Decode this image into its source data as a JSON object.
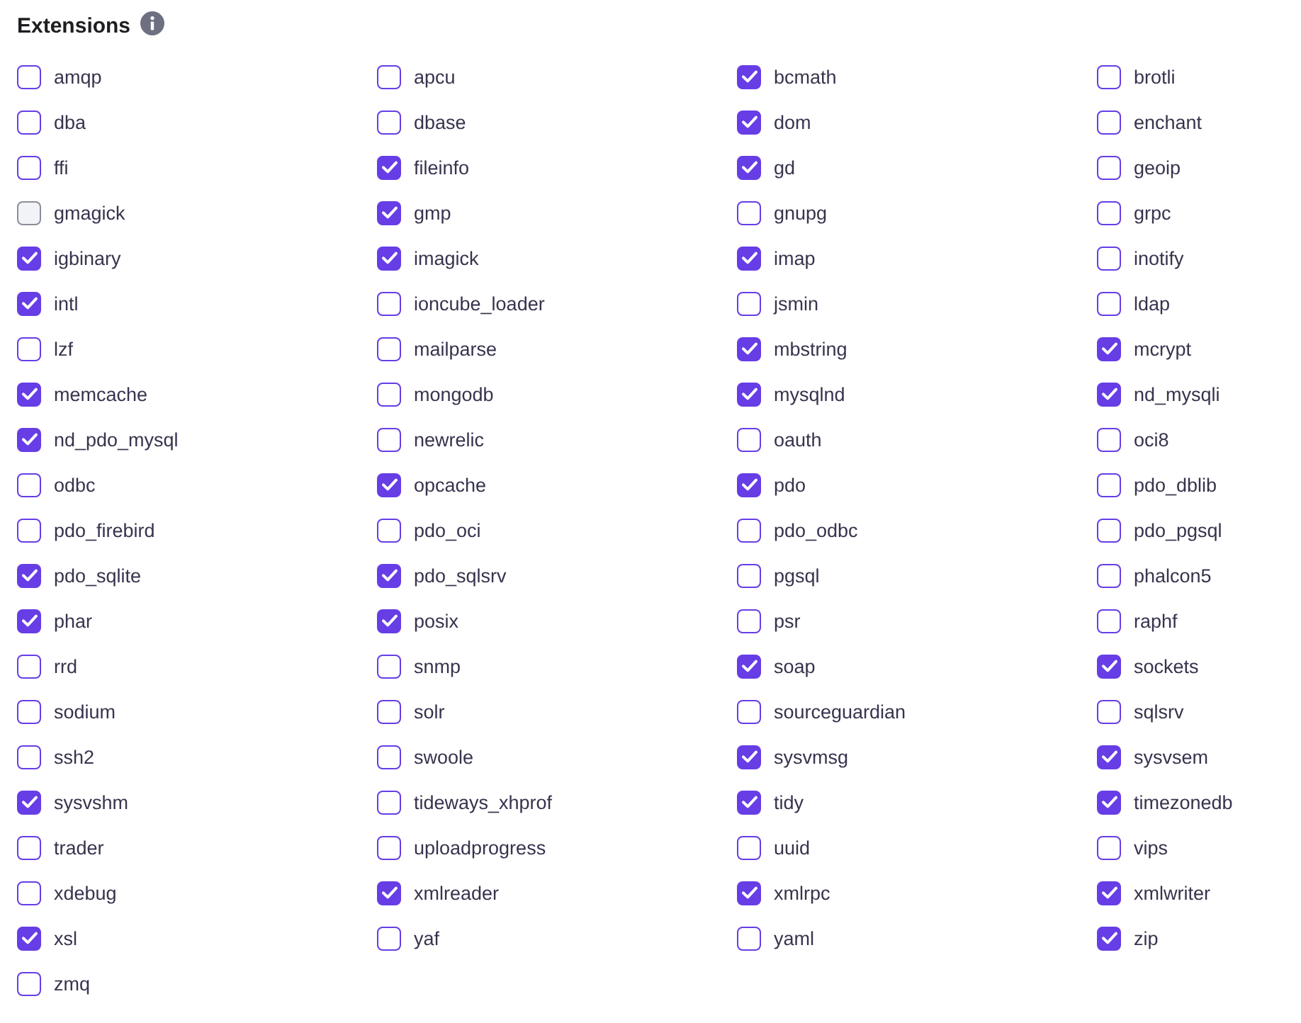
{
  "title": "Extensions",
  "extensions": [
    {
      "name": "amqp",
      "checked": false,
      "disabled": false
    },
    {
      "name": "apcu",
      "checked": false,
      "disabled": false
    },
    {
      "name": "bcmath",
      "checked": true,
      "disabled": false
    },
    {
      "name": "brotli",
      "checked": false,
      "disabled": false
    },
    {
      "name": "dba",
      "checked": false,
      "disabled": false
    },
    {
      "name": "dbase",
      "checked": false,
      "disabled": false
    },
    {
      "name": "dom",
      "checked": true,
      "disabled": false
    },
    {
      "name": "enchant",
      "checked": false,
      "disabled": false
    },
    {
      "name": "ffi",
      "checked": false,
      "disabled": false
    },
    {
      "name": "fileinfo",
      "checked": true,
      "disabled": false
    },
    {
      "name": "gd",
      "checked": true,
      "disabled": false
    },
    {
      "name": "geoip",
      "checked": false,
      "disabled": false
    },
    {
      "name": "gmagick",
      "checked": false,
      "disabled": true
    },
    {
      "name": "gmp",
      "checked": true,
      "disabled": false
    },
    {
      "name": "gnupg",
      "checked": false,
      "disabled": false
    },
    {
      "name": "grpc",
      "checked": false,
      "disabled": false
    },
    {
      "name": "igbinary",
      "checked": true,
      "disabled": false
    },
    {
      "name": "imagick",
      "checked": true,
      "disabled": false
    },
    {
      "name": "imap",
      "checked": true,
      "disabled": false
    },
    {
      "name": "inotify",
      "checked": false,
      "disabled": false
    },
    {
      "name": "intl",
      "checked": true,
      "disabled": false
    },
    {
      "name": "ioncube_loader",
      "checked": false,
      "disabled": false
    },
    {
      "name": "jsmin",
      "checked": false,
      "disabled": false
    },
    {
      "name": "ldap",
      "checked": false,
      "disabled": false
    },
    {
      "name": "lzf",
      "checked": false,
      "disabled": false
    },
    {
      "name": "mailparse",
      "checked": false,
      "disabled": false
    },
    {
      "name": "mbstring",
      "checked": true,
      "disabled": false
    },
    {
      "name": "mcrypt",
      "checked": true,
      "disabled": false
    },
    {
      "name": "memcache",
      "checked": true,
      "disabled": false
    },
    {
      "name": "mongodb",
      "checked": false,
      "disabled": false
    },
    {
      "name": "mysqlnd",
      "checked": true,
      "disabled": false
    },
    {
      "name": "nd_mysqli",
      "checked": true,
      "disabled": false
    },
    {
      "name": "nd_pdo_mysql",
      "checked": true,
      "disabled": false
    },
    {
      "name": "newrelic",
      "checked": false,
      "disabled": false
    },
    {
      "name": "oauth",
      "checked": false,
      "disabled": false
    },
    {
      "name": "oci8",
      "checked": false,
      "disabled": false
    },
    {
      "name": "odbc",
      "checked": false,
      "disabled": false
    },
    {
      "name": "opcache",
      "checked": true,
      "disabled": false
    },
    {
      "name": "pdo",
      "checked": true,
      "disabled": false
    },
    {
      "name": "pdo_dblib",
      "checked": false,
      "disabled": false
    },
    {
      "name": "pdo_firebird",
      "checked": false,
      "disabled": false
    },
    {
      "name": "pdo_oci",
      "checked": false,
      "disabled": false
    },
    {
      "name": "pdo_odbc",
      "checked": false,
      "disabled": false
    },
    {
      "name": "pdo_pgsql",
      "checked": false,
      "disabled": false
    },
    {
      "name": "pdo_sqlite",
      "checked": true,
      "disabled": false
    },
    {
      "name": "pdo_sqlsrv",
      "checked": true,
      "disabled": false
    },
    {
      "name": "pgsql",
      "checked": false,
      "disabled": false
    },
    {
      "name": "phalcon5",
      "checked": false,
      "disabled": false
    },
    {
      "name": "phar",
      "checked": true,
      "disabled": false
    },
    {
      "name": "posix",
      "checked": true,
      "disabled": false
    },
    {
      "name": "psr",
      "checked": false,
      "disabled": false
    },
    {
      "name": "raphf",
      "checked": false,
      "disabled": false
    },
    {
      "name": "rrd",
      "checked": false,
      "disabled": false
    },
    {
      "name": "snmp",
      "checked": false,
      "disabled": false
    },
    {
      "name": "soap",
      "checked": true,
      "disabled": false
    },
    {
      "name": "sockets",
      "checked": true,
      "disabled": false
    },
    {
      "name": "sodium",
      "checked": false,
      "disabled": false
    },
    {
      "name": "solr",
      "checked": false,
      "disabled": false
    },
    {
      "name": "sourceguardian",
      "checked": false,
      "disabled": false
    },
    {
      "name": "sqlsrv",
      "checked": false,
      "disabled": false
    },
    {
      "name": "ssh2",
      "checked": false,
      "disabled": false
    },
    {
      "name": "swoole",
      "checked": false,
      "disabled": false
    },
    {
      "name": "sysvmsg",
      "checked": true,
      "disabled": false
    },
    {
      "name": "sysvsem",
      "checked": true,
      "disabled": false
    },
    {
      "name": "sysvshm",
      "checked": true,
      "disabled": false
    },
    {
      "name": "tideways_xhprof",
      "checked": false,
      "disabled": false
    },
    {
      "name": "tidy",
      "checked": true,
      "disabled": false
    },
    {
      "name": "timezonedb",
      "checked": true,
      "disabled": false
    },
    {
      "name": "trader",
      "checked": false,
      "disabled": false
    },
    {
      "name": "uploadprogress",
      "checked": false,
      "disabled": false
    },
    {
      "name": "uuid",
      "checked": false,
      "disabled": false
    },
    {
      "name": "vips",
      "checked": false,
      "disabled": false
    },
    {
      "name": "xdebug",
      "checked": false,
      "disabled": false
    },
    {
      "name": "xmlreader",
      "checked": true,
      "disabled": false
    },
    {
      "name": "xmlrpc",
      "checked": true,
      "disabled": false
    },
    {
      "name": "xmlwriter",
      "checked": true,
      "disabled": false
    },
    {
      "name": "xsl",
      "checked": true,
      "disabled": false
    },
    {
      "name": "yaf",
      "checked": false,
      "disabled": false
    },
    {
      "name": "yaml",
      "checked": false,
      "disabled": false
    },
    {
      "name": "zip",
      "checked": true,
      "disabled": false
    },
    {
      "name": "zmq",
      "checked": false,
      "disabled": false
    }
  ]
}
